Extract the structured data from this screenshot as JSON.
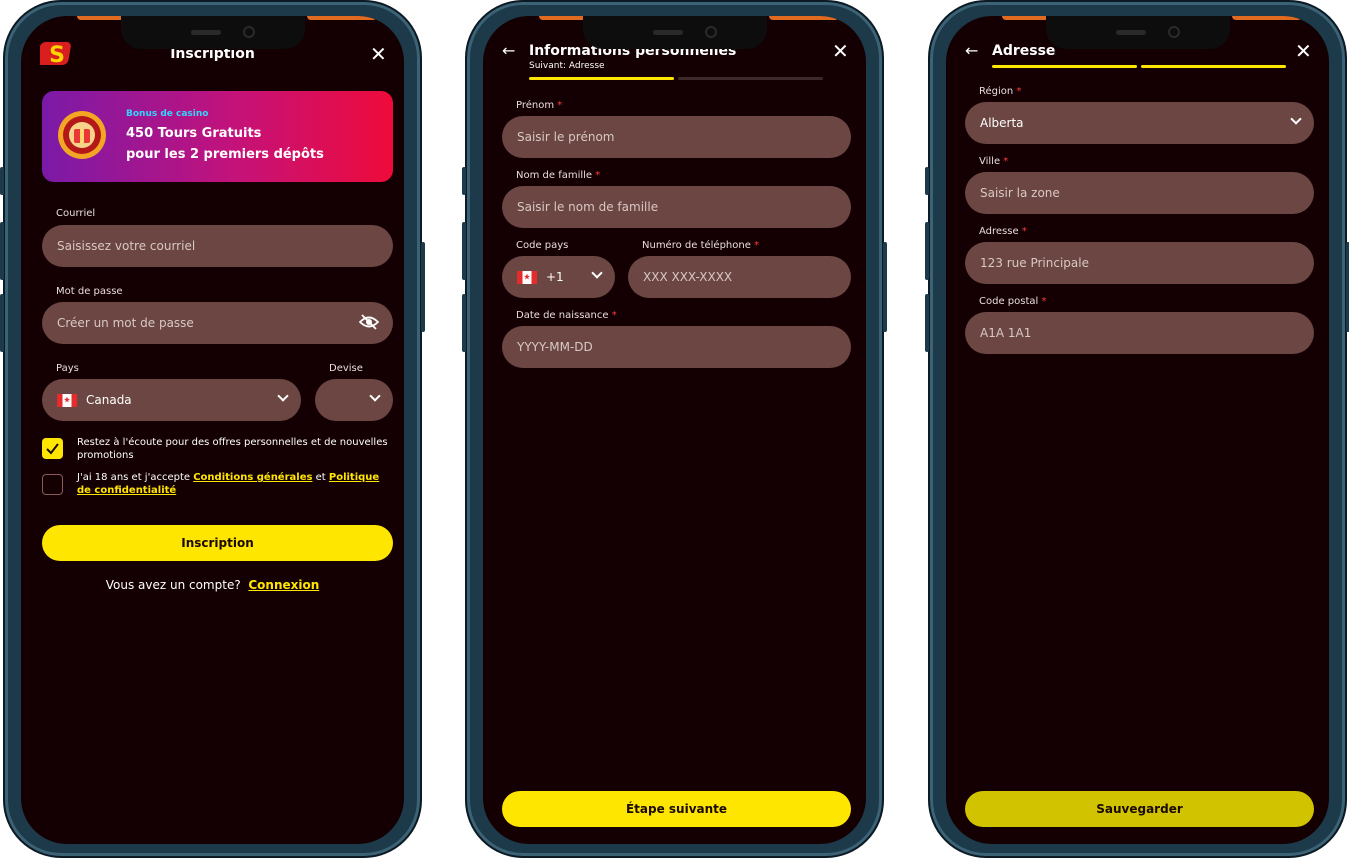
{
  "screen1": {
    "title": "Inscription",
    "bonus_tag": "Bonus de casino",
    "bonus_line1": "450 Tours Gratuits",
    "bonus_line2": "pour les 2 premiers dépôts",
    "email_label": "Courriel",
    "email_placeholder": "Saisissez votre courriel",
    "password_label": "Mot de passe",
    "password_placeholder": "Créer un mot de passe",
    "country_label": "Pays",
    "country_value": "Canada",
    "currency_label": "Devise",
    "offers_text": "Restez à l'écoute pour des offres personnelles et de nouvelles promotions",
    "offers_checked": true,
    "terms_prefix": "J'ai 18 ans et j'accepte ",
    "terms_link": "Conditions générales",
    "terms_and": " et ",
    "privacy_link": "Politique de confidentialité",
    "submit_label": "Inscription",
    "account_prompt": "Vous avez un compte?",
    "login_link": "Connexion"
  },
  "screen2": {
    "title": "Informations personnelles",
    "subtitle": "Suivant: Adresse",
    "first_name_label": "Prénom",
    "first_name_placeholder": "Saisir le prénom",
    "last_name_label": "Nom de famille",
    "last_name_placeholder": "Saisir le nom de famille",
    "country_code_label": "Code pays",
    "country_code_value": "+1",
    "phone_label": "Numéro de téléphone",
    "phone_placeholder": "XXX XXX-XXXX",
    "dob_label": "Date de naissance",
    "dob_placeholder": "YYYY-MM-DD",
    "next_label": "Étape suivante",
    "required_mark": "*"
  },
  "screen3": {
    "title": "Adresse",
    "region_label": "Région",
    "region_value": "Alberta",
    "city_label": "Ville",
    "city_placeholder": "Saisir la zone",
    "address_label": "Adresse",
    "address_placeholder": "123 rue Principale",
    "postal_label": "Code postal",
    "postal_placeholder": "A1A 1A1",
    "save_label": "Sauvegarder"
  },
  "colors": {
    "background": "#140003",
    "field": "#6b4642",
    "accent": "#ffe600",
    "required": "#ff3b3b"
  }
}
